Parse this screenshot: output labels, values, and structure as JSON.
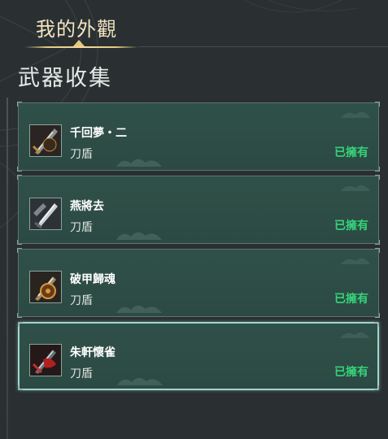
{
  "header": {
    "tab_label": "我的外觀",
    "section_title": "武器收集"
  },
  "weapons": [
    {
      "name": "千回夢・二",
      "type": "刀盾",
      "status": "已擁有",
      "icon": "sword-icon"
    },
    {
      "name": "燕將去",
      "type": "刀盾",
      "status": "已擁有",
      "icon": "sword-icon"
    },
    {
      "name": "破甲歸魂",
      "type": "刀盾",
      "status": "已擁有",
      "icon": "sword-icon"
    },
    {
      "name": "朱軒懷雀",
      "type": "刀盾",
      "status": "已擁有",
      "icon": "sword-icon"
    }
  ],
  "colors": {
    "accent_gold": "#e6c882",
    "owned_green": "#35d37a",
    "card_bg": "#2f5048",
    "selected_border": "#9fd6cf"
  }
}
